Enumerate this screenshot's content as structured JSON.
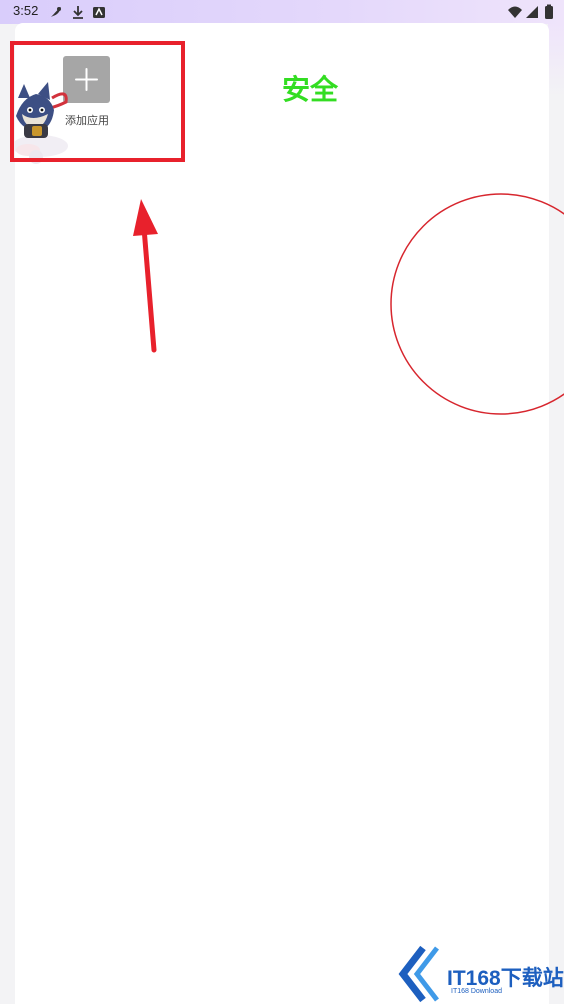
{
  "status_bar": {
    "time": "3:52",
    "left_icons": [
      "feather-icon",
      "download-icon",
      "app-icon"
    ],
    "right_icons": [
      "wifi-icon",
      "signal-icon",
      "battery-icon"
    ]
  },
  "page": {
    "title": "安全",
    "title_color": "#33dd22"
  },
  "add_app": {
    "label": "添加应用",
    "icon": "plus-icon"
  },
  "annotations": {
    "color": "#e8212c",
    "shapes": [
      "highlight-box",
      "arrow",
      "circle"
    ]
  },
  "watermark": {
    "main": "IT168下载站",
    "sub": "IT168 Download"
  }
}
